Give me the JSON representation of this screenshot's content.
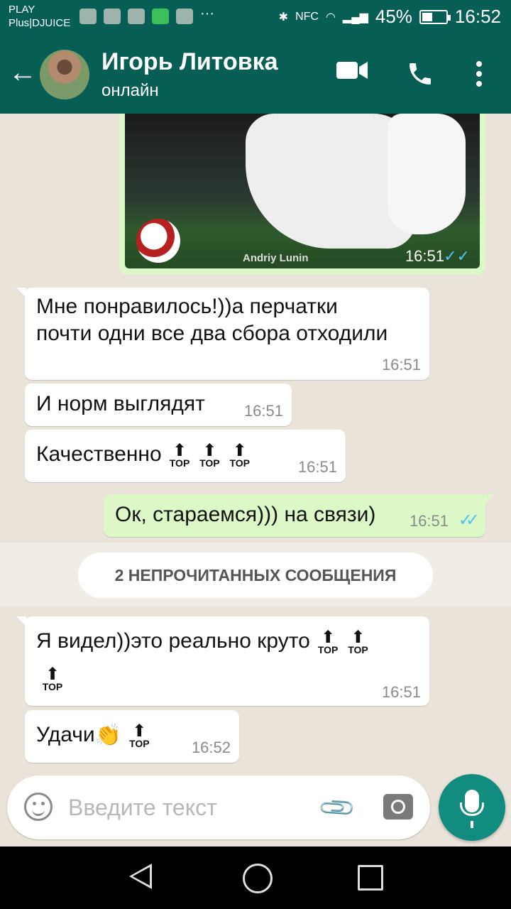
{
  "status_bar": {
    "carrier_line1": "PLAY",
    "carrier_line2": "Plus|DJUICE",
    "nfc": "NFC",
    "battery_percent": "45%",
    "battery_level": 0.45,
    "time": "16:52"
  },
  "header": {
    "contact_name": "Игорь Литовка",
    "contact_status": "онлайн"
  },
  "photo_message": {
    "caption": "Andriy Lunin",
    "time": "16:51",
    "read": true
  },
  "messages": [
    {
      "direction": "in",
      "text_line1": "Мне понравилось!))а перчатки",
      "text_line2": "почти одни все два сбора отходили",
      "time": "16:51"
    },
    {
      "direction": "in",
      "text": "И норм выглядят",
      "time": "16:51"
    },
    {
      "direction": "in",
      "text": "Качественно",
      "emoji_label": "TOP",
      "time": "16:51"
    },
    {
      "direction": "out",
      "text": "Ок, стараемся))) на связи)",
      "time": "16:51",
      "read": true
    },
    {
      "direction": "in",
      "text": "Я видел))это реально круто",
      "emoji_label": "TOP",
      "time": "16:51"
    },
    {
      "direction": "in",
      "text": "Удачи",
      "emoji_label": "TOP",
      "time": "16:52"
    }
  ],
  "unread_divider": "2 НЕПРОЧИТАННЫХ СООБЩЕНИЯ",
  "composer": {
    "placeholder": "Введите текст"
  },
  "icons": {
    "back": "arrow-left-icon",
    "video_call": "video-camera-icon",
    "voice_call": "phone-icon",
    "menu": "more-vert-icon",
    "emoji": "smiley-icon",
    "attach": "paperclip-icon",
    "camera": "camera-icon",
    "mic": "mic-icon"
  },
  "colors": {
    "header": "#075e54",
    "outgoing_bubble": "#dcf8c6",
    "read_ticks": "#4fc3f7",
    "mic_button": "#128c7e"
  }
}
